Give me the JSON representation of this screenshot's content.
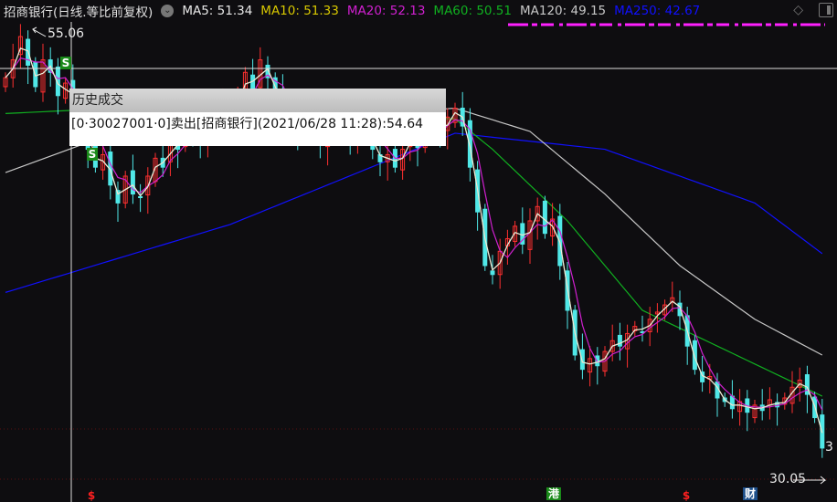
{
  "header": {
    "title": "招商银行(日线.等比前复权)",
    "dropdown_icon": "chevron-down-icon",
    "ma": [
      {
        "label": "MA5: 51.34",
        "color": "#e8e8e8"
      },
      {
        "label": "MA10: 51.33",
        "color": "#d8c800"
      },
      {
        "label": "MA20: 52.13",
        "color": "#d020d0"
      },
      {
        "label": "MA60: 50.51",
        "color": "#10b020"
      },
      {
        "label": "MA120: 49.15",
        "color": "#c8c8c8"
      },
      {
        "label": "MA250: 42.67",
        "color": "#1010ff"
      }
    ]
  },
  "tooltip": {
    "title": "历史成交",
    "text": "[0·30027001·0]卖出[招商银行](2021/06/28 11:28):54.64"
  },
  "markers": {
    "s1": "S",
    "s2": "S",
    "dollar1": "$",
    "dollar2": "$",
    "hk": "港",
    "fin": "财"
  },
  "chart_data": {
    "type": "candlestick",
    "title": "招商银行(日线.等比前复权)",
    "ylim": [
      29.5,
      56
    ],
    "annotations": {
      "high_label": "55.06",
      "low_label": "30.05",
      "last_label": "3"
    },
    "colors": {
      "up": "#ff3030",
      "down": "#50e8e8"
    },
    "close": [
      52.5,
      53.5,
      54.8,
      53.2,
      52,
      53.5,
      52.8,
      51.5,
      52.2,
      51,
      50.5,
      48.5,
      47.5,
      48.2,
      46.5,
      45.5,
      47,
      46,
      45.8,
      47,
      48,
      47.5,
      49,
      48.5,
      50,
      49.2,
      48.8,
      50.5,
      49.8,
      51,
      50.2,
      51.5,
      52.8,
      51.8,
      53.5,
      52.5,
      51.5,
      50.8,
      50,
      49.5,
      50.2,
      49.3,
      48.8,
      49.5,
      50.3,
      49.8,
      49,
      50.2,
      49.6,
      48.5,
      47.8,
      48.2,
      47.5,
      48.5,
      49.2,
      48.6,
      49.5,
      50.1,
      49.4,
      50.3,
      50.8,
      49.8,
      47.5,
      45,
      42,
      41.5,
      42.8,
      43.5,
      44.2,
      43.2,
      44.5,
      45.3,
      43.8,
      44.6,
      42,
      39.5,
      37,
      36.2,
      36.8,
      36.4,
      37.2,
      37.8,
      37.5,
      38.2,
      38.6,
      38.3,
      39,
      39.4,
      39.8,
      40.2,
      39.2,
      37.5,
      36.2,
      35.5,
      35.8,
      34.6,
      34.4,
      34,
      34.4,
      33.8,
      34.2,
      33.9,
      34.5,
      34.1,
      34.6,
      35.2,
      35.6,
      34.8,
      33.5,
      31.8
    ],
    "ma_long": {
      "MA60": [
        [
          0,
          50.5
        ],
        [
          15,
          50.8
        ],
        [
          60,
          50.2
        ],
        [
          65,
          48.5
        ],
        [
          75,
          44.5
        ],
        [
          85,
          39.5
        ],
        [
          95,
          37.5
        ],
        [
          109,
          34.7
        ]
      ],
      "MA120": [
        [
          0,
          47.2
        ],
        [
          15,
          49.5
        ],
        [
          60,
          50.8
        ],
        [
          70,
          49.5
        ],
        [
          80,
          46
        ],
        [
          90,
          42
        ],
        [
          100,
          39
        ],
        [
          109,
          37
        ]
      ],
      "MA250": [
        [
          0,
          40.5
        ],
        [
          30,
          44.3
        ],
        [
          60,
          49.4
        ],
        [
          80,
          48.5
        ],
        [
          100,
          45.5
        ],
        [
          109,
          42.67
        ]
      ]
    }
  }
}
